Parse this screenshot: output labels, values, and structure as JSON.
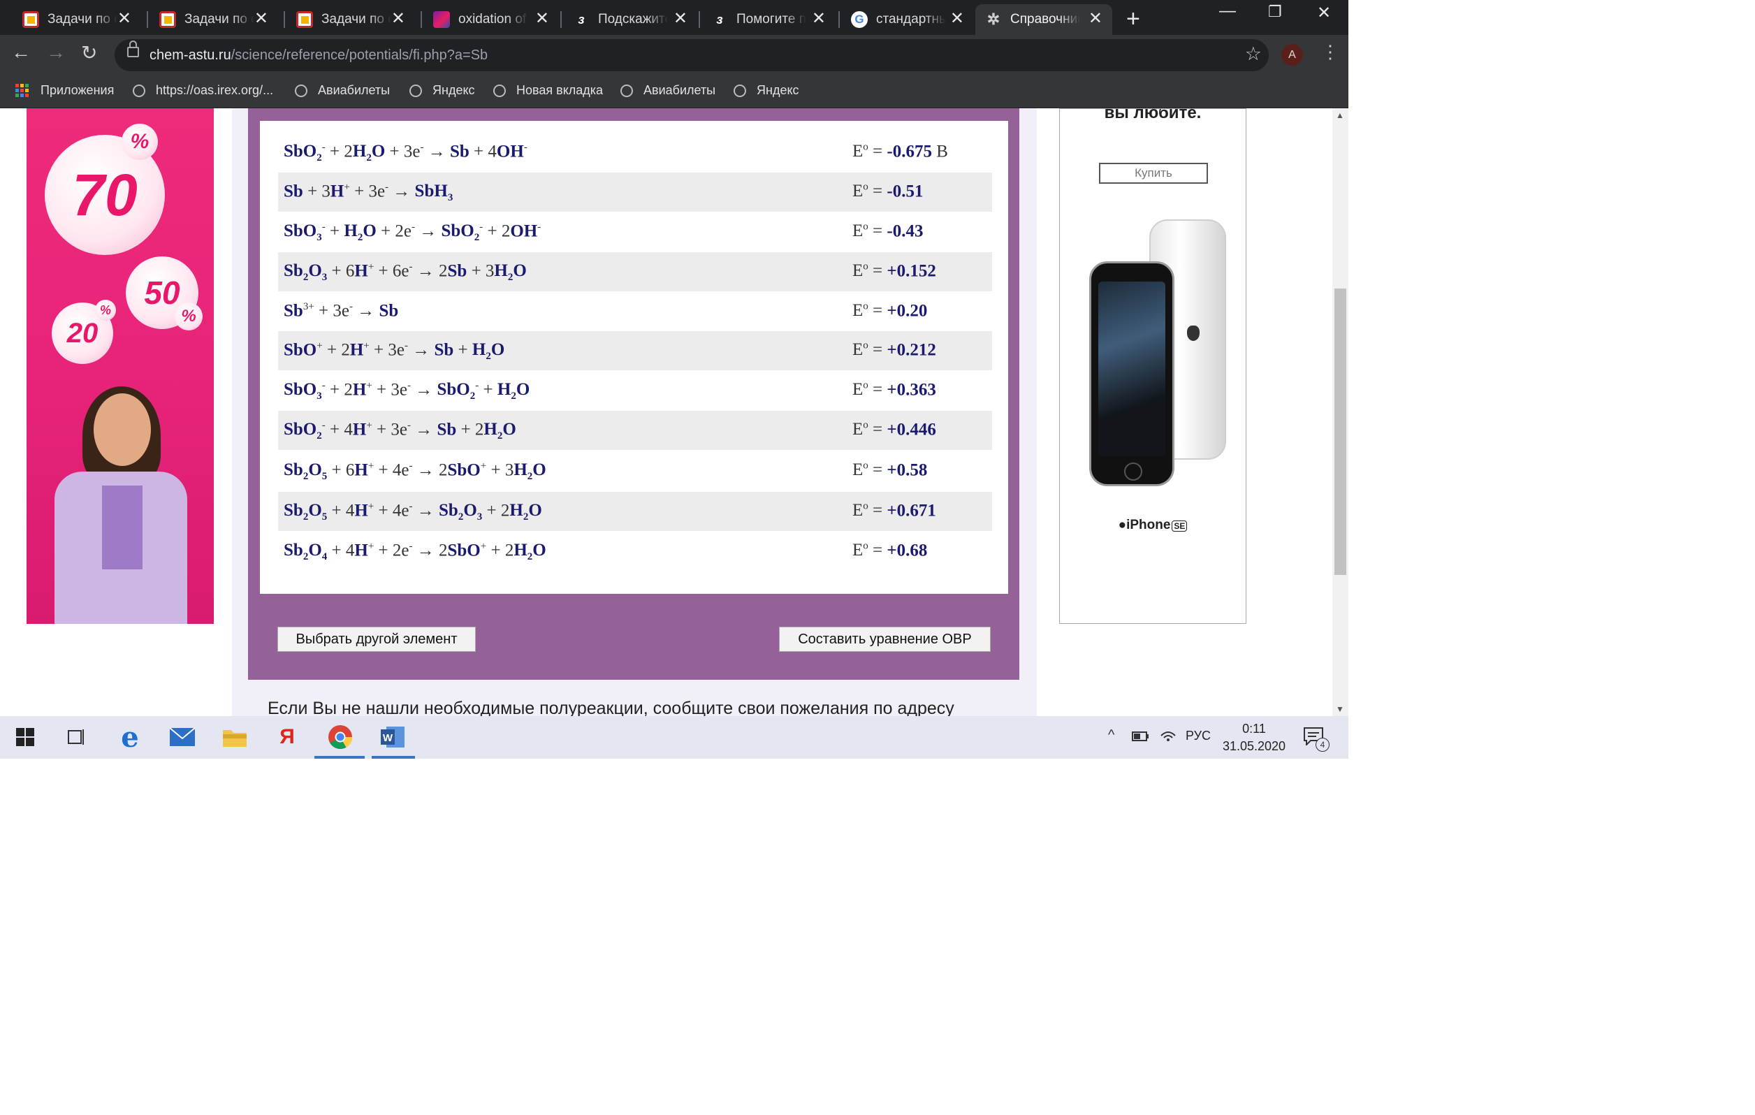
{
  "browser": {
    "tabs": [
      {
        "title": "Задачи по ф",
        "icon": "slides-icon"
      },
      {
        "title": "Задачи по ф",
        "icon": "slides-icon"
      },
      {
        "title": "Задачи по ф",
        "icon": "slides-icon"
      },
      {
        "title": "oxidation of",
        "icon": "magenta-icon"
      },
      {
        "title": "Подскажите",
        "icon": "znanija-icon",
        "icon_glyph": "з"
      },
      {
        "title": "Помогите п",
        "icon": "znanija-icon",
        "icon_glyph": "з"
      },
      {
        "title": "стандартны",
        "icon": "google-icon",
        "icon_glyph": "G"
      },
      {
        "title": "Справочник",
        "icon": "atom-icon",
        "icon_glyph": "✲",
        "active": true
      }
    ],
    "url_domain": "chem-astu.ru",
    "url_path": "/science/reference/potentials/fi.php?a=Sb",
    "profile_initial": "A",
    "bookmarks": [
      "Приложения",
      "https://oas.irex.org/...",
      "Авиабилеты",
      "Яндекс",
      "Новая вкладка",
      "Авиабилеты",
      "Яндекс"
    ]
  },
  "reactions": [
    {
      "eq": "<b>SbO<sub>2</sub></b><sup>-</sup> + 2<b>H<sub>2</sub>O</b> + 3e<sup>-</sup> → <b>Sb</b> + 4<b>OH</b><sup>-</sup>",
      "label": "E<sup>o</sup> = ",
      "value": "-0.675",
      "unit": " В"
    },
    {
      "eq": "<b>Sb</b> + 3<b>H</b><sup>+</sup> + 3e<sup>-</sup> → <b>SbH<sub>3</sub></b>",
      "label": "E<sup>o</sup> = ",
      "value": "-0.51",
      "unit": ""
    },
    {
      "eq": "<b>SbO<sub>3</sub></b><sup>-</sup> + <b>H<sub>2</sub>O</b> + 2e<sup>-</sup> → <b>SbO<sub>2</sub></b><sup>-</sup> + 2<b>OH</b><sup>-</sup>",
      "label": "E<sup>o</sup> = ",
      "value": "-0.43",
      "unit": ""
    },
    {
      "eq": "<b>Sb<sub>2</sub>O<sub>3</sub></b> + 6<b>H</b><sup>+</sup> + 6e<sup>-</sup> → 2<b>Sb</b> + 3<b>H<sub>2</sub>O</b>",
      "label": "E<sup>o</sup> = ",
      "value": "+0.152",
      "unit": ""
    },
    {
      "eq": "<b>Sb</b><sup>3+</sup> + 3e<sup>-</sup> → <b>Sb</b>",
      "label": "E<sup>o</sup> = ",
      "value": "+0.20",
      "unit": ""
    },
    {
      "eq": "<b>SbO</b><sup>+</sup> + 2<b>H</b><sup>+</sup> + 3e<sup>-</sup> → <b>Sb</b> + <b>H<sub>2</sub>O</b>",
      "label": "E<sup>o</sup> = ",
      "value": "+0.212",
      "unit": ""
    },
    {
      "eq": "<b>SbO<sub>3</sub></b><sup>-</sup> + 2<b>H</b><sup>+</sup> + 3e<sup>-</sup> → <b>SbO<sub>2</sub></b><sup>-</sup> + <b>H<sub>2</sub>O</b>",
      "label": "E<sup>o</sup> = ",
      "value": "+0.363",
      "unit": ""
    },
    {
      "eq": "<b>SbO<sub>2</sub></b><sup>-</sup> + 4<b>H</b><sup>+</sup> + 3e<sup>-</sup> → <b>Sb</b> + 2<b>H<sub>2</sub>O</b>",
      "label": "E<sup>o</sup> = ",
      "value": "+0.446",
      "unit": ""
    },
    {
      "eq": "<b>Sb<sub>2</sub>O<sub>5</sub></b> + 6<b>H</b><sup>+</sup> + 4e<sup>-</sup> → 2<b>SbO</b><sup>+</sup> + 3<b>H<sub>2</sub>O</b>",
      "label": "E<sup>o</sup> = ",
      "value": "+0.58",
      "unit": ""
    },
    {
      "eq": "<b>Sb<sub>2</sub>O<sub>5</sub></b> + 4<b>H</b><sup>+</sup> + 4e<sup>-</sup> → <b>Sb<sub>2</sub>O<sub>3</sub></b> + 2<b>H<sub>2</sub>O</b>",
      "label": "E<sup>o</sup> = ",
      "value": "+0.671",
      "unit": ""
    },
    {
      "eq": "<b>Sb<sub>2</sub>O<sub>4</sub></b> + 4<b>H</b><sup>+</sup> + 2e<sup>-</sup> → 2<b>SbO</b><sup>+</sup> + 2<b>H<sub>2</sub>O</b>",
      "label": "E<sup>o</sup> = ",
      "value": "+0.68",
      "unit": ""
    }
  ],
  "buttons": {
    "choose_element": "Выбрать другой элемент",
    "compose_redox": "Составить уравнение ОВР"
  },
  "note": "Если Вы не нашли необходимые полуреакции, сообщите свои пожелания по адресу",
  "ads": {
    "left": {
      "big": "70",
      "mid": "50",
      "small": "20",
      "percent": "%"
    },
    "right": {
      "heading": "вы любите.",
      "buy": "Купить",
      "brand": "iPhone",
      "brand_badge": "SE"
    }
  },
  "taskbar": {
    "lang": "РУС",
    "time": "0:11",
    "date": "31.05.2020",
    "notifications": "4"
  },
  "colors": {
    "chrome_dark": "#202124",
    "chrome_toolbar": "#35363a",
    "panel_purple": "#946298",
    "formula_blue": "#1a1a6e",
    "ad_pink": "#ee2a7b",
    "taskbar": "#e4e6f2"
  }
}
